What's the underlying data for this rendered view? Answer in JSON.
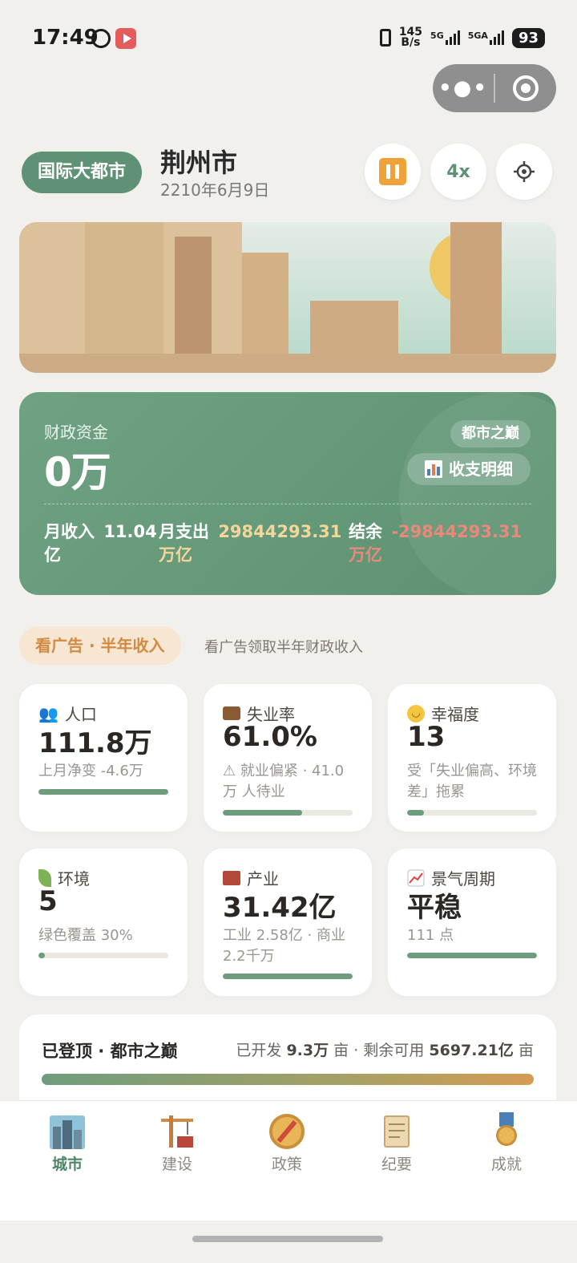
{
  "status_bar": {
    "time": "17:49",
    "network_speed": "145\nB/s",
    "signal_1": "5G",
    "signal_2": "5GA",
    "battery": "93"
  },
  "header": {
    "level_badge": "国际大都市",
    "city_name": "荆州市",
    "date": "2210年6月9日",
    "speed_label": "4x"
  },
  "finance": {
    "label": "财政资金",
    "value": "0万",
    "tag": "都市之巅",
    "detail_button": "收支明细",
    "income_label": "月收入",
    "income_value": "11.04",
    "income_unit": "亿",
    "expense_label": "月支出",
    "expense_value": "29844293.31",
    "expense_unit": "万亿",
    "balance_label": "结余",
    "balance_value": "-29844293.31",
    "balance_unit": "万亿",
    "colors": {
      "income": "#ffffff",
      "expense": "#f3d79a",
      "balance": "#e9897a"
    }
  },
  "ad": {
    "button": "看广告 · 半年收入",
    "description": "看广告领取半年财政收入"
  },
  "stats": [
    {
      "icon": "people-icon",
      "title": "人口",
      "value": "111.8万",
      "sub": "上月净变 -4.6万",
      "progress": 1.0
    },
    {
      "icon": "briefcase-icon",
      "title": "失业率",
      "value": "61.0%",
      "sub": "⚠ 就业偏紧 · 41.0万 人待业",
      "progress": 0.61
    },
    {
      "icon": "smile-icon",
      "title": "幸福度",
      "value": "13",
      "sub": "受「失业偏高、环境差」拖累",
      "progress": 0.13
    },
    {
      "icon": "leaf-icon",
      "title": "环境",
      "value": "5",
      "sub": "绿色覆盖 30%",
      "progress": 0.05
    },
    {
      "icon": "factory-icon",
      "title": "产业",
      "value": "31.42亿",
      "sub": "工业 2.58亿 · 商业 2.2千万",
      "progress": 1.0
    },
    {
      "icon": "trend-up-icon",
      "title": "景气周期",
      "value": "平稳",
      "sub": "111 点",
      "progress": 1.0
    }
  ],
  "land": {
    "title": "已登顶 · 都市之巅",
    "developed_label": "已开发",
    "developed_value": "9.3万",
    "developed_unit": "亩",
    "remaining_label": "剩余可用",
    "remaining_value": "5697.21亿",
    "remaining_unit": "亩"
  },
  "tabs": [
    {
      "label": "城市",
      "icon": "city-icon",
      "active": true
    },
    {
      "label": "建设",
      "icon": "crane-icon",
      "active": false
    },
    {
      "label": "政策",
      "icon": "compass-icon",
      "active": false
    },
    {
      "label": "纪要",
      "icon": "scroll-icon",
      "active": false
    },
    {
      "label": "成就",
      "icon": "medal-icon",
      "active": false
    }
  ]
}
